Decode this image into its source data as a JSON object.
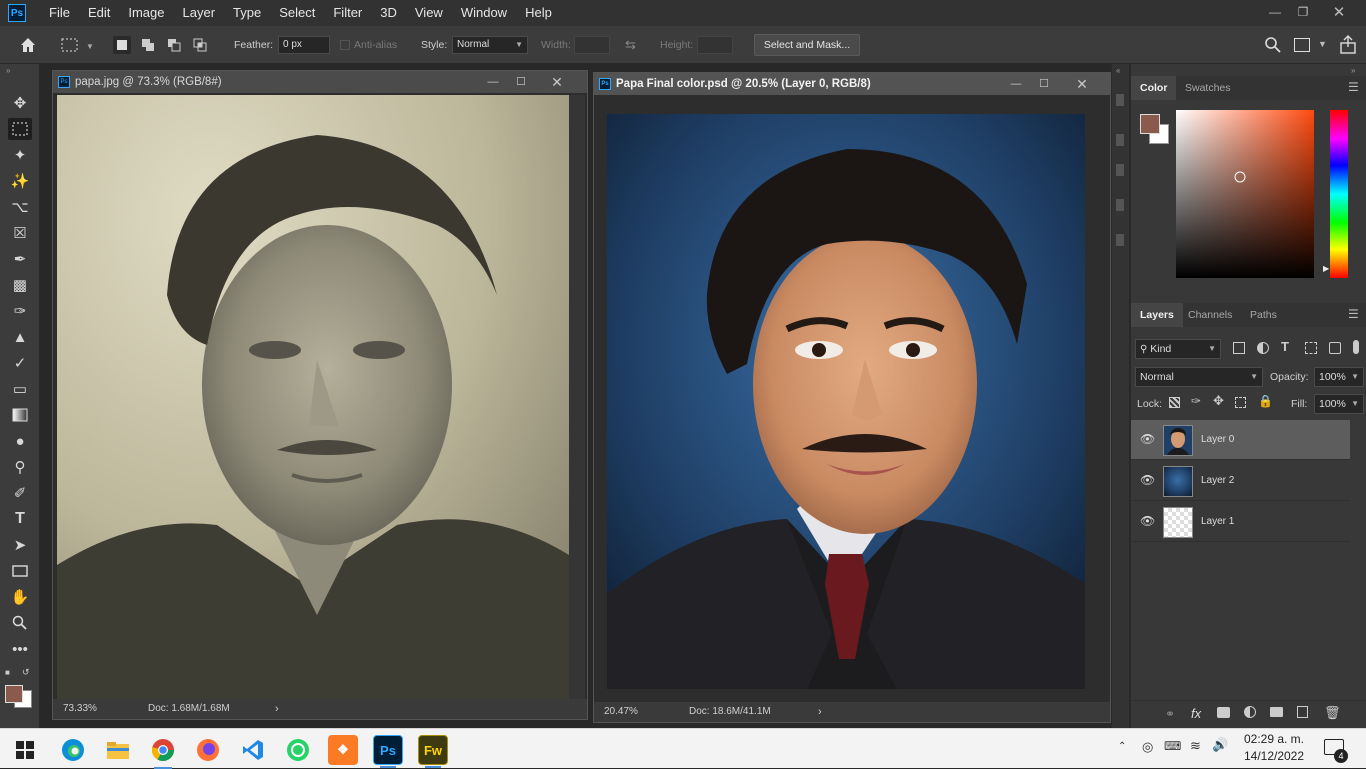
{
  "app": {
    "logo": "Ps",
    "menu": [
      "File",
      "Edit",
      "Image",
      "Layer",
      "Type",
      "Select",
      "Filter",
      "3D",
      "View",
      "Window",
      "Help"
    ]
  },
  "options_bar": {
    "feather_label": "Feather:",
    "feather_value": "0 px",
    "antialias_label": "Anti-alias",
    "style_label": "Style:",
    "style_value": "Normal",
    "width_label": "Width:",
    "height_label": "Height:",
    "select_mask_label": "Select and Mask..."
  },
  "documents": [
    {
      "title": "papa.jpg @ 73.3% (RGB/8#)",
      "zoom": "73.33%",
      "doc_info": "Doc: 1.68M/1.68M"
    },
    {
      "title": "Papa Final color.psd @ 20.5% (Layer 0, RGB/8)",
      "zoom": "20.47%",
      "doc_info": "Doc: 18.6M/41.1M"
    }
  ],
  "color_panel": {
    "tabs": [
      "Color",
      "Swatches"
    ],
    "foreground": "#8a5a4c",
    "background": "#ffffff"
  },
  "layers_panel": {
    "tabs": [
      "Layers",
      "Channels",
      "Paths"
    ],
    "filter_kind": "Kind",
    "blend_mode": "Normal",
    "opacity_label": "Opacity:",
    "opacity_value": "100%",
    "lock_label": "Lock:",
    "fill_label": "Fill:",
    "fill_value": "100%",
    "layers": [
      {
        "name": "Layer 0",
        "selected": true
      },
      {
        "name": "Layer 2",
        "selected": false
      },
      {
        "name": "Layer 1",
        "selected": false
      }
    ]
  },
  "taskbar": {
    "time": "02:29 a. m.",
    "date": "14/12/2022",
    "notification_count": "4",
    "apps": [
      "windows-start",
      "edge",
      "file-explorer",
      "chrome",
      "firefox",
      "vscode",
      "whatsapp",
      "xampp",
      "photoshop",
      "fireworks"
    ]
  },
  "colors": {
    "accent": "#31a8ff",
    "panel_bg": "#383838",
    "canvas_bg": "#282828"
  }
}
